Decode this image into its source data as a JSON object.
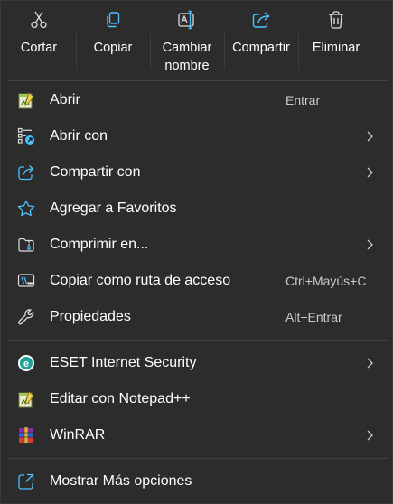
{
  "colors": {
    "background": "#2c2c2c",
    "accent": "#4cc2ff",
    "divider": "#404040",
    "shortcut_text": "#c9c9c9"
  },
  "toolbar": {
    "cut": {
      "label": "Cortar",
      "icon": "scissors-icon"
    },
    "copy": {
      "label": "Copiar",
      "icon": "copy-icon"
    },
    "rename": {
      "label_line1": "Cambiar",
      "label_line2": "nombre",
      "icon": "rename-icon"
    },
    "share": {
      "label": "Compartir",
      "icon": "share-icon"
    },
    "delete": {
      "label": "Eliminar",
      "icon": "trash-icon"
    }
  },
  "items": [
    {
      "label": "Abrir",
      "shortcut": "Entrar",
      "icon": "notepadpp-icon",
      "submenu": false
    },
    {
      "label": "Abrir con",
      "shortcut": "",
      "icon": "open-with-icon",
      "submenu": true
    },
    {
      "label": "Compartir con",
      "shortcut": "",
      "icon": "share-icon",
      "submenu": true
    },
    {
      "label": "Agregar a Favoritos",
      "shortcut": "",
      "icon": "star-icon",
      "submenu": false
    },
    {
      "label": "Comprimir en...",
      "shortcut": "",
      "icon": "zip-folder-icon",
      "submenu": true
    },
    {
      "label": "Copiar como ruta de acceso",
      "shortcut": "Ctrl+Mayús+C",
      "icon": "copy-path-icon",
      "submenu": false
    },
    {
      "label": "Propiedades",
      "shortcut": "Alt+Entrar",
      "icon": "wrench-icon",
      "submenu": false
    },
    {
      "label": "ESET Internet Security",
      "shortcut": "",
      "icon": "eset-icon",
      "submenu": true
    },
    {
      "label": "Editar con Notepad++",
      "shortcut": "",
      "icon": "notepadpp-icon",
      "submenu": false
    },
    {
      "label": "WinRAR",
      "shortcut": "",
      "icon": "winrar-icon",
      "submenu": true
    },
    {
      "label": "Mostrar Más opciones",
      "shortcut": "",
      "icon": "external-icon",
      "submenu": false
    }
  ]
}
